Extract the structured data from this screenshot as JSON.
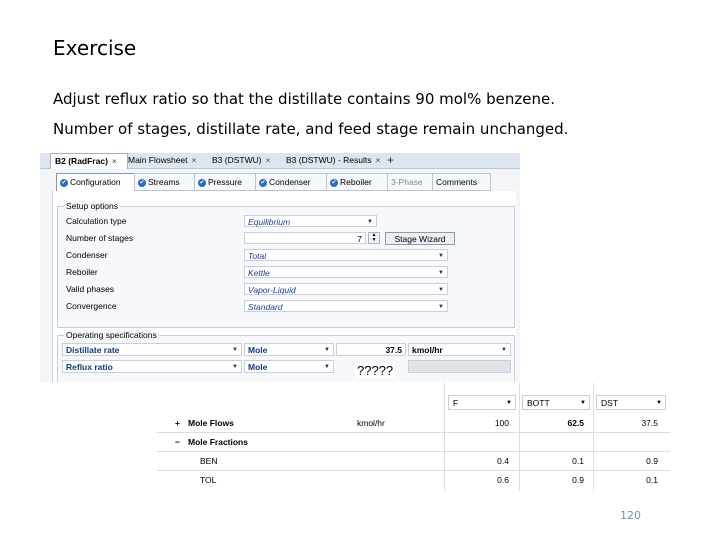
{
  "slide": {
    "title": "Exercise",
    "line1": "Adjust reflux ratio so that the distillate contains 90 mol% benzene.",
    "line2": "Number of stages, distillate rate, and feed stage remain unchanged.",
    "page_number": "120"
  },
  "doc_tabs": [
    {
      "label": "B2 (RadFrac)",
      "close": "×"
    },
    {
      "label": "Main Flowsheet",
      "close": "×"
    },
    {
      "label": "B3 (DSTWU)",
      "close": "×"
    },
    {
      "label": "B3 (DSTWU) - Results",
      "close": "×"
    }
  ],
  "add_tab": "+",
  "sub_tabs": [
    "Configuration",
    "Streams",
    "Pressure",
    "Condenser",
    "Reboiler",
    "3-Phase",
    "Comments"
  ],
  "setup": {
    "title": "Setup options",
    "rows": [
      {
        "label": "Calculation type",
        "value": "Equilibrium"
      },
      {
        "label": "Number of stages",
        "value": "7"
      },
      {
        "label": "Condenser",
        "value": "Total"
      },
      {
        "label": "Reboiler",
        "value": "Kettle"
      },
      {
        "label": "Valid phases",
        "value": "Vapor-Liquid"
      },
      {
        "label": "Convergence",
        "value": "Standard"
      }
    ],
    "stage_wizard": "Stage Wizard"
  },
  "specs": {
    "title": "Operating specifications",
    "rows": [
      {
        "spec": "Distillate rate",
        "basis": "Mole",
        "value": "37.5",
        "unit": "kmol/hr"
      },
      {
        "spec": "Reflux ratio",
        "basis": "Mole",
        "value": "",
        "unit": ""
      }
    ],
    "unknown": "?????"
  },
  "results": {
    "streams": [
      "F",
      "BOTT",
      "DST"
    ],
    "rows": [
      {
        "toggle": "+",
        "label": "Mole Flows",
        "unit": "kmol/hr",
        "values": [
          "100",
          "62.5",
          "37.5"
        ]
      },
      {
        "toggle": "−",
        "label": "Mole Fractions",
        "unit": "",
        "values": [
          "",
          "",
          ""
        ]
      },
      {
        "toggle": "",
        "label": "BEN",
        "unit": "",
        "values": [
          "0.4",
          "0.1",
          "0.9"
        ]
      },
      {
        "toggle": "",
        "label": "TOL",
        "unit": "",
        "values": [
          "0.6",
          "0.9",
          "0.1"
        ]
      }
    ]
  }
}
